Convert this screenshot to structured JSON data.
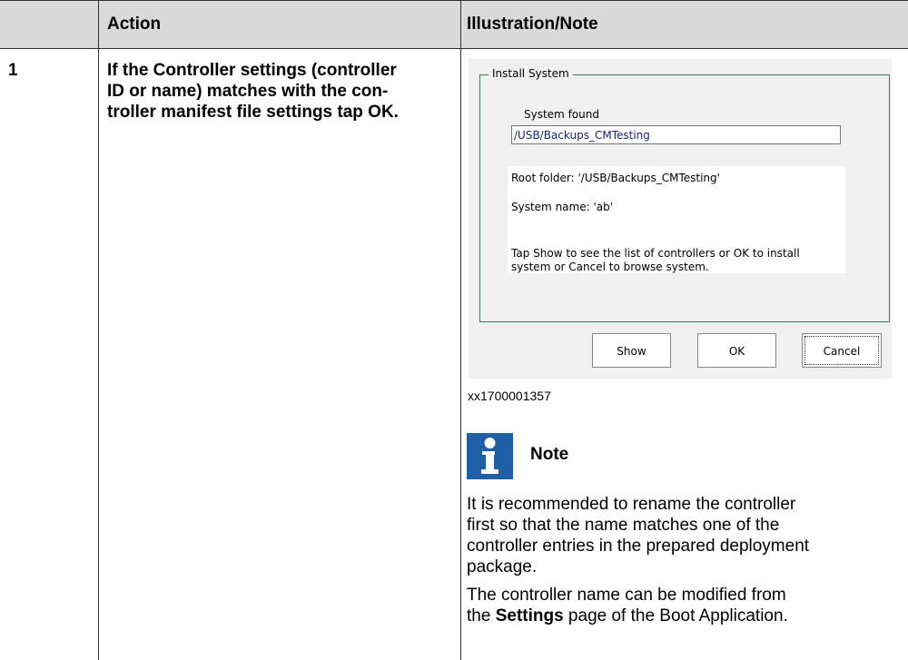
{
  "header": {
    "action": "Action",
    "illustration": "Illustration/Note"
  },
  "row": {
    "number": "1",
    "action_lines": [
      "If the Controller settings (controller",
      "ID or name) matches with the con-",
      "troller manifest file settings tap "
    ],
    "action_ok": "OK",
    "action_end": "."
  },
  "dialog": {
    "group_title": "Install System",
    "found_label": "System found",
    "path_value": "/USB/Backups_CMTesting",
    "root_folder": "Root folder: '/USB/Backups_CMTesting'",
    "system_name": "System name: 'ab'",
    "hint_line1": "Tap Show to see the list of controllers or OK to install",
    "hint_line2": "system or Cancel to browse system.",
    "buttons": {
      "show": "Show",
      "ok": "OK",
      "cancel": "Cancel"
    }
  },
  "figure_id": "xx1700001357",
  "note": {
    "title": "Note",
    "icon": "info-icon",
    "icon_color": "#1f5fa6",
    "para1": [
      "It is recommended to rename the controller",
      "first so that the name matches one of the",
      "controller entries in the prepared deployment",
      "package."
    ],
    "para2_line1": "The controller name can be modified from",
    "para2_pre": "the ",
    "para2_bold": "Settings",
    "para2_post": " page of the Boot Application."
  }
}
